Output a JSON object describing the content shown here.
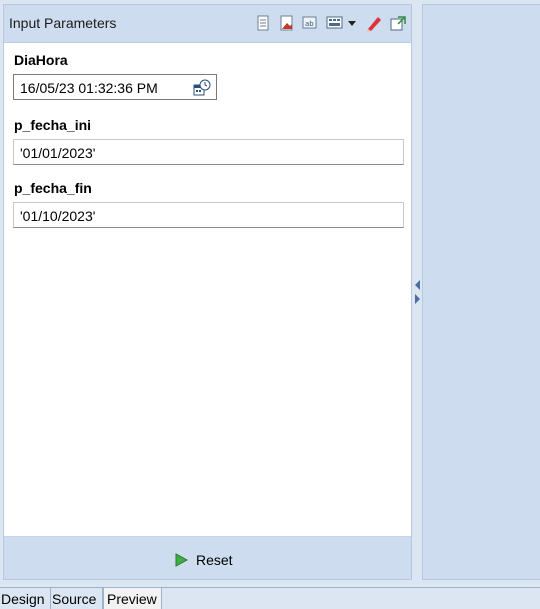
{
  "panel": {
    "title": "Input Parameters",
    "toolbar_icons": [
      "export-icon",
      "bookmark-icon",
      "find-icon",
      "layout-icon",
      "dropdown-arrow-icon",
      "edit-pencil-icon",
      "new-window-icon"
    ]
  },
  "params": [
    {
      "label": "DiaHora",
      "value": "16/05/23 01:32:36 PM",
      "type": "datetime"
    },
    {
      "label": "p_fecha_ini",
      "value": "'01/01/2023'",
      "type": "text"
    },
    {
      "label": "p_fecha_fin",
      "value": "'01/10/2023'",
      "type": "text"
    }
  ],
  "footer": {
    "reset_label": "Reset"
  },
  "tabs": [
    {
      "label": "Design",
      "active": false
    },
    {
      "label": "Source",
      "active": false
    },
    {
      "label": "Preview",
      "active": true
    }
  ],
  "colors": {
    "header_bg": "#cddcee",
    "window_bg": "#dbe6f2",
    "accent_red": "#e0303a",
    "play_green": "#3fae49"
  }
}
